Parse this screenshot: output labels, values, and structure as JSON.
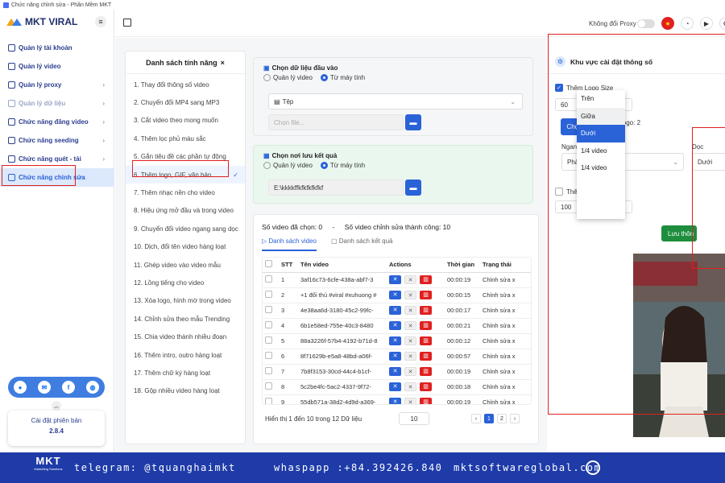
{
  "window": {
    "title": "Chức năng chỉnh sửa - Phần Mềm MKT"
  },
  "sidebar": {
    "brand": "MKT VIRAL",
    "items": [
      {
        "label": "Quản lý tài khoản",
        "chevron": false,
        "state": "normal"
      },
      {
        "label": "Quản lý video",
        "chevron": false,
        "state": "normal"
      },
      {
        "label": "Quản lý proxy",
        "chevron": true,
        "state": "normal"
      },
      {
        "label": "Quản lý dữ liệu",
        "chevron": true,
        "state": "dim"
      },
      {
        "label": "Chức năng đăng video",
        "chevron": true,
        "state": "normal"
      },
      {
        "label": "Chức năng seeding",
        "chevron": true,
        "state": "normal"
      },
      {
        "label": "Chức năng quét - tải",
        "chevron": true,
        "state": "normal"
      },
      {
        "label": "Chức năng chỉnh sửa",
        "chevron": false,
        "state": "active"
      }
    ],
    "version_label": "Cài đặt phiên bản",
    "version_value": "2.8.4"
  },
  "topbar": {
    "proxy_label": "Không đổi Proxy"
  },
  "features": {
    "title": "Danh sách tính năng",
    "items": [
      "1. Thay đổi thông số video",
      "2. Chuyển đổi MP4 sang MP3",
      "3. Cắt video theo mong muốn",
      "4. Thêm lọc phủ màu sắc",
      "5. Gắn tiêu đề các phần tự động",
      "6. Thêm logo, GIF, văn bản",
      "7. Thêm nhạc nền cho video",
      "8. Hiệu ứng mở đầu và trong video",
      "9. Chuyển đổi video ngang sang dọc",
      "10. Dịch, đổi tên video hàng loạt",
      "11. Ghép video vào video mẫu",
      "12. Lồng tiếng cho video",
      "13. Xóa logo, hình mờ trong video",
      "14. Chỉnh sửa theo mẫu Trending",
      "15. Chia video thành nhiều đoạn",
      "16. Thêm intro, outro hàng loạt",
      "17. Thêm chữ ký hàng loạt",
      "18. Gộp nhiều video hàng loạt"
    ],
    "active_index": 5
  },
  "input": {
    "title": "Chọn dữ liệu đầu vào",
    "radio_a": "Quản lý video",
    "radio_b": "Từ máy tính",
    "type_value": "Tệp",
    "file_placeholder": "Chọn file..."
  },
  "output": {
    "title": "Chọn nơi lưu kết quả",
    "radio_a": "Quản lý video",
    "radio_b": "Từ máy tính",
    "path_value": "E:\\kkkkffkfkfkfkfkf"
  },
  "videos": {
    "selected_label": "Số video đã chọn: 0",
    "sep": "-",
    "success_label": "Số video chỉnh sửa thành công: 10",
    "tab_list": "Danh sách video",
    "tab_results": "Danh sách kết quả",
    "columns": [
      "STT",
      "Tên video",
      "Actions",
      "Thời gian",
      "Trạng thái"
    ],
    "rows": [
      {
        "stt": "1",
        "name": "3af16c73-6cfe-438a-abf7-3",
        "time": "00:00:19",
        "status": "Chỉnh sửa x"
      },
      {
        "stt": "2",
        "name": "+1 đối thủ #viral #xuhuong #",
        "time": "00:00:15",
        "status": "Chỉnh sửa x"
      },
      {
        "stt": "3",
        "name": "4e38aa6d-3180-45c2-99fc-",
        "time": "00:00:17",
        "status": "Chỉnh sửa x"
      },
      {
        "stt": "4",
        "name": "6b1e58ed-755e-40c3-8480",
        "time": "00:00:21",
        "status": "Chỉnh sửa x"
      },
      {
        "stt": "5",
        "name": "88a3226f-57b4-4192-b71d-8",
        "time": "00:00:12",
        "status": "Chỉnh sửa x"
      },
      {
        "stt": "6",
        "name": "8f71629b-e5a8-48bd-a06f-",
        "time": "00:00:57",
        "status": "Chỉnh sửa x"
      },
      {
        "stt": "7",
        "name": "7b8f3153-30cd-44c4-b1cf-",
        "time": "00:00:19",
        "status": "Chỉnh sửa x"
      },
      {
        "stt": "8",
        "name": "5c2be4fc-5ac2-4337-9f72-",
        "time": "00:00:18",
        "status": "Chỉnh sửa x"
      },
      {
        "stt": "9",
        "name": "55db571a-38d2-4d9d-a369-",
        "time": "00:00:19",
        "status": "Chỉnh sửa x"
      }
    ],
    "footer": "Hiển thị 1 đến 10 trong 12 Dữ liệu",
    "page_size": "10",
    "pages": [
      "1",
      "2"
    ]
  },
  "settings": {
    "title": "Khu vực cài đặt thông số",
    "logo_size_label": "Thêm Logo Size",
    "logo_w": "60",
    "logo_h": "88",
    "x": "x",
    "choose_logo": "Chọn Logo",
    "logo_count": "Số logo: 2",
    "horizontal_label": "Ngang",
    "horizontal_value": "Phải",
    "vertical_label": "Dọc",
    "vertical_value": "Dưới",
    "gif_size_label": "Thêm Ảnh Gif Size",
    "gif_w": "100",
    "gif_h": "100",
    "save_label": "Lưu thôn"
  },
  "dropdown": {
    "options": [
      "Trên",
      "Giữa",
      "Dưới",
      "1/4 video",
      "1/4 video"
    ],
    "hover_index": 1,
    "selected_index": 2
  },
  "footer": {
    "logo": "MKT",
    "logo_sub": "Marketing Solutions",
    "telegram": "telegram: @tquanghaimkt",
    "whatsapp": "whaspapp :+84.392426.840",
    "site": "mktsoftwareglobal.com"
  },
  "colors": {
    "primary": "#2a62d8",
    "danger": "#e02020",
    "success": "#1e8e3e",
    "footer": "#1e3ba8"
  }
}
